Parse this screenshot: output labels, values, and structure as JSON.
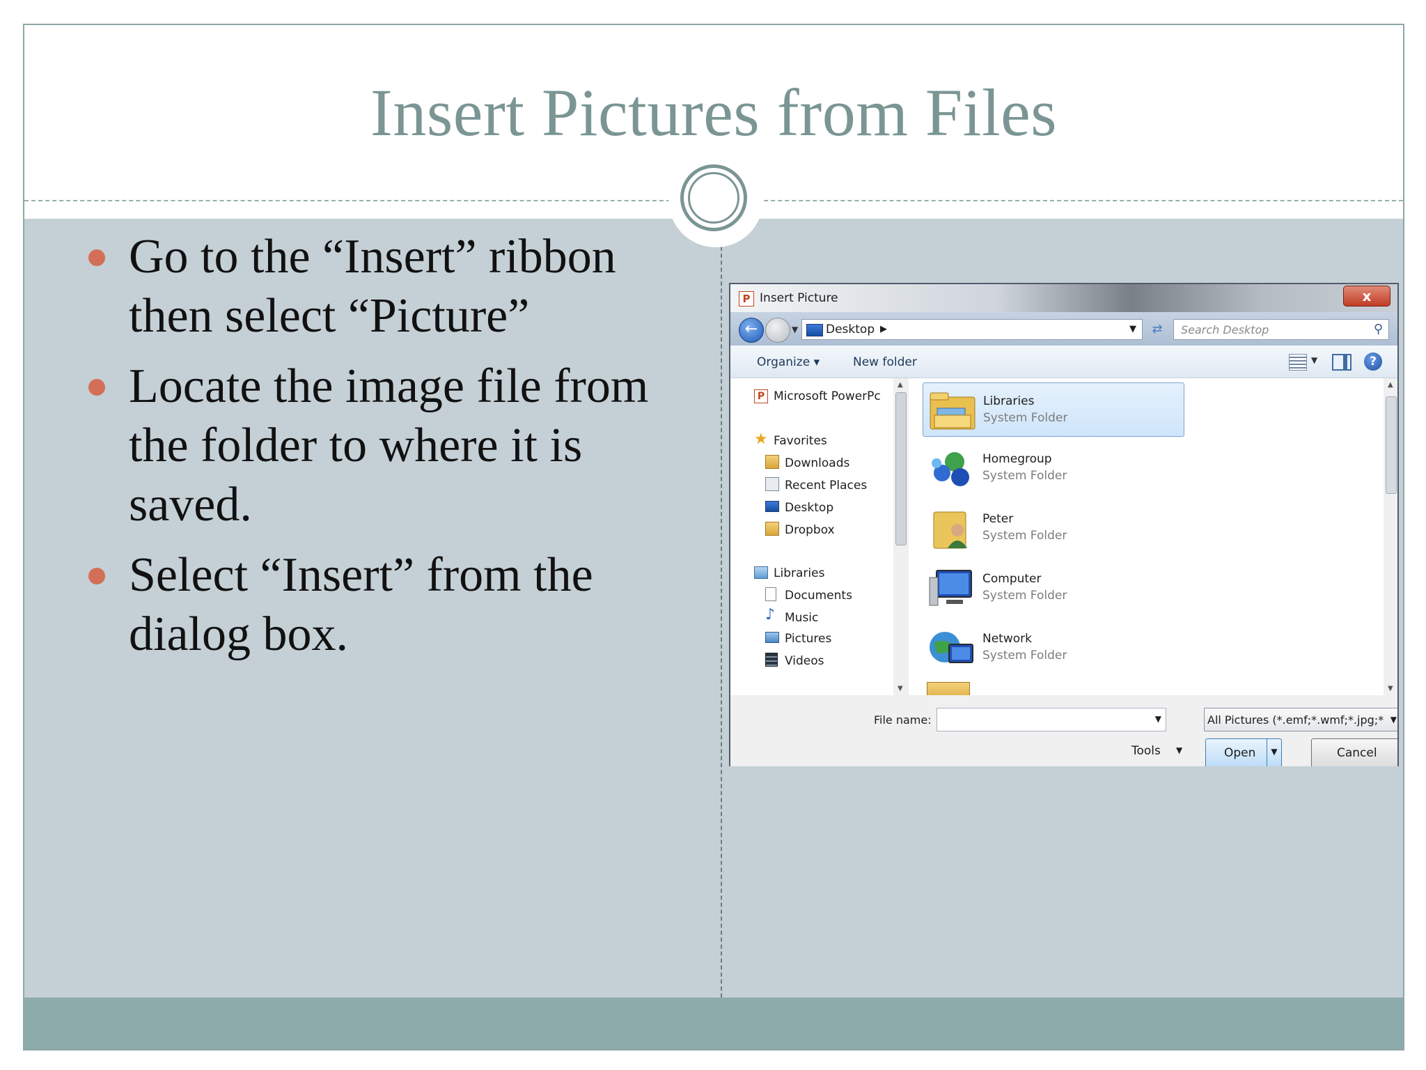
{
  "slide": {
    "title": "Insert Pictures from Files",
    "bullets": [
      "Go to the “Insert” ribbon then select “Picture”",
      "Locate the image file from the folder to where it is saved.",
      "Select “Insert” from the dialog box."
    ]
  },
  "dialog": {
    "title": "Insert Picture",
    "close_label": "x",
    "address": "Desktop",
    "search_placeholder": "Search Desktop",
    "toolbar": {
      "organize": "Organize ▾",
      "new_folder": "New folder"
    },
    "nav": {
      "powerpoint": "Microsoft PowerPc",
      "favorites": "Favorites",
      "downloads": "Downloads",
      "recent_places": "Recent Places",
      "desktop": "Desktop",
      "dropbox": "Dropbox",
      "libraries": "Libraries",
      "documents": "Documents",
      "music": "Music",
      "pictures": "Pictures",
      "videos": "Videos"
    },
    "items": [
      {
        "name": "Libraries",
        "type": "System Folder"
      },
      {
        "name": "Homegroup",
        "type": "System Folder"
      },
      {
        "name": "Peter",
        "type": "System Folder"
      },
      {
        "name": "Computer",
        "type": "System Folder"
      },
      {
        "name": "Network",
        "type": "System Folder"
      }
    ],
    "file_name_label": "File name:",
    "file_name_value": "",
    "filter": "All Pictures (*.emf;*.wmf;*.jpg;*",
    "tools_label": "Tools",
    "open_label": "Open",
    "cancel_label": "Cancel"
  },
  "colors": {
    "title": "#7a9594",
    "body_bg": "#c5d0d6",
    "footer": "#8eabab",
    "bullet_dot": "#d36f56"
  }
}
